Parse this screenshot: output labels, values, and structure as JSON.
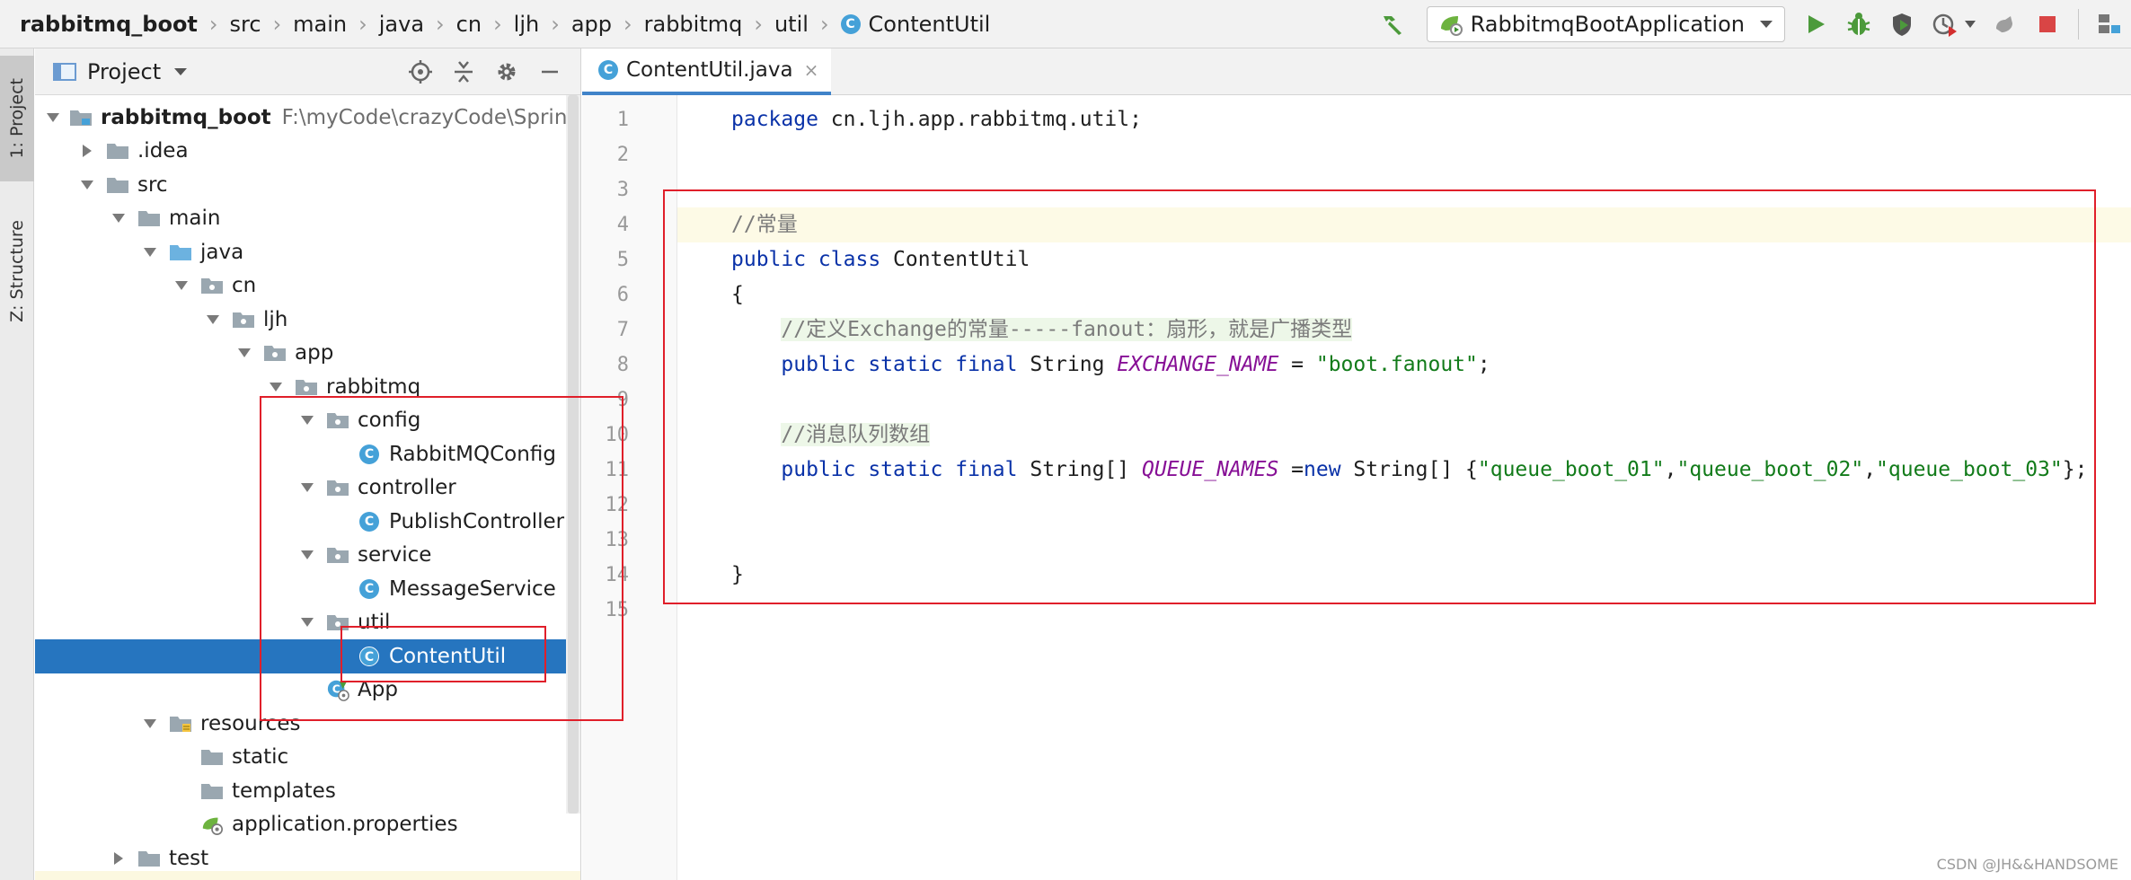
{
  "breadcrumbs": [
    "rabbitmq_boot",
    "src",
    "main",
    "java",
    "cn",
    "ljh",
    "app",
    "rabbitmq",
    "util",
    "ContentUtil"
  ],
  "breadcrumb_class_badge": "C",
  "run_config": "RabbitmqBootApplication",
  "toolbar_icons": [
    "hammer-icon",
    "run-icon",
    "debug-icon",
    "coverage-icon",
    "profile-icon",
    "attach-icon",
    "stop-icon",
    "structure-icon"
  ],
  "left_strip": {
    "tab1": "1: Project",
    "tab2": "Z: Structure"
  },
  "project_panel": {
    "title": "Project",
    "tree": [
      {
        "label": "rabbitmq_boot",
        "path": "F:\\myCode\\crazyCode\\SpringBoot",
        "bold": true,
        "icon": "module",
        "level": 0,
        "arrow": "down"
      },
      {
        "label": ".idea",
        "icon": "folder",
        "level": 1,
        "arrow": "right"
      },
      {
        "label": "src",
        "icon": "folder",
        "level": 1,
        "arrow": "down"
      },
      {
        "label": "main",
        "icon": "folder",
        "level": 2,
        "arrow": "down"
      },
      {
        "label": "java",
        "icon": "source-folder",
        "level": 3,
        "arrow": "down"
      },
      {
        "label": "cn",
        "icon": "package",
        "level": 4,
        "arrow": "down"
      },
      {
        "label": "ljh",
        "icon": "package",
        "level": 5,
        "arrow": "down"
      },
      {
        "label": "app",
        "icon": "package",
        "level": 6,
        "arrow": "down"
      },
      {
        "label": "rabbitmq",
        "icon": "package",
        "level": 7,
        "arrow": "down"
      },
      {
        "label": "config",
        "icon": "package",
        "level": 8,
        "arrow": "down"
      },
      {
        "label": "RabbitMQConfig",
        "icon": "class",
        "level": 9,
        "arrow": "none"
      },
      {
        "label": "controller",
        "icon": "package",
        "level": 8,
        "arrow": "down"
      },
      {
        "label": "PublishController",
        "icon": "class",
        "level": 9,
        "arrow": "none"
      },
      {
        "label": "service",
        "icon": "package",
        "level": 8,
        "arrow": "down"
      },
      {
        "label": "MessageService",
        "icon": "class",
        "level": 9,
        "arrow": "none"
      },
      {
        "label": "util",
        "icon": "package",
        "level": 8,
        "arrow": "down"
      },
      {
        "label": "ContentUtil",
        "icon": "class",
        "level": 9,
        "arrow": "none",
        "selected": true
      },
      {
        "label": "App",
        "icon": "spring-class",
        "level": 8,
        "arrow": "none"
      },
      {
        "label": "resources",
        "icon": "resources-folder",
        "level": 3,
        "arrow": "down"
      },
      {
        "label": "static",
        "icon": "folder",
        "level": 4,
        "arrow": "none"
      },
      {
        "label": "templates",
        "icon": "folder",
        "level": 4,
        "arrow": "none"
      },
      {
        "label": "application.properties",
        "icon": "spring-properties",
        "level": 4,
        "arrow": "none"
      },
      {
        "label": "test",
        "icon": "folder",
        "level": 2,
        "arrow": "right"
      }
    ]
  },
  "editor": {
    "tab_label": "ContentUtil.java",
    "tab_close": "×",
    "current_line": 4,
    "lines": [
      [
        {
          "t": "package",
          "c": "kw"
        },
        {
          "t": " cn.ljh.app.rabbitmq.util;"
        }
      ],
      [],
      [],
      [
        {
          "t": "//常量",
          "c": "cmt"
        }
      ],
      [
        {
          "t": "public class",
          "c": "kw"
        },
        {
          "t": " ContentUtil"
        }
      ],
      [
        {
          "t": "{"
        }
      ],
      [
        {
          "t": "    "
        },
        {
          "t": "//定义Exchange的常量-----fanout：扇形，就是广播类型",
          "c": "cmt cmtbg"
        }
      ],
      [
        {
          "t": "    "
        },
        {
          "t": "public static final",
          "c": "kw"
        },
        {
          "t": " String "
        },
        {
          "t": "EXCHANGE_NAME",
          "c": "fld"
        },
        {
          "t": " = "
        },
        {
          "t": "\"boot.fanout\"",
          "c": "str"
        },
        {
          "t": ";"
        }
      ],
      [],
      [
        {
          "t": "    "
        },
        {
          "t": "//消息队列数组",
          "c": "cmt cmtbg"
        }
      ],
      [
        {
          "t": "    "
        },
        {
          "t": "public static final",
          "c": "kw"
        },
        {
          "t": " String[] "
        },
        {
          "t": "QUEUE_NAMES",
          "c": "fld"
        },
        {
          "t": " ="
        },
        {
          "t": "new",
          "c": "kw"
        },
        {
          "t": " String[] {"
        },
        {
          "t": "\"queue_boot_01\"",
          "c": "str"
        },
        {
          "t": ","
        },
        {
          "t": "\"queue_boot_02\"",
          "c": "str"
        },
        {
          "t": ","
        },
        {
          "t": "\"queue_boot_03\"",
          "c": "str"
        },
        {
          "t": "};"
        }
      ],
      [],
      [],
      [
        {
          "t": "}"
        }
      ],
      []
    ]
  },
  "annotation_color": "#e01f2a",
  "watermark": "CSDN @JH&&HANDSOME"
}
